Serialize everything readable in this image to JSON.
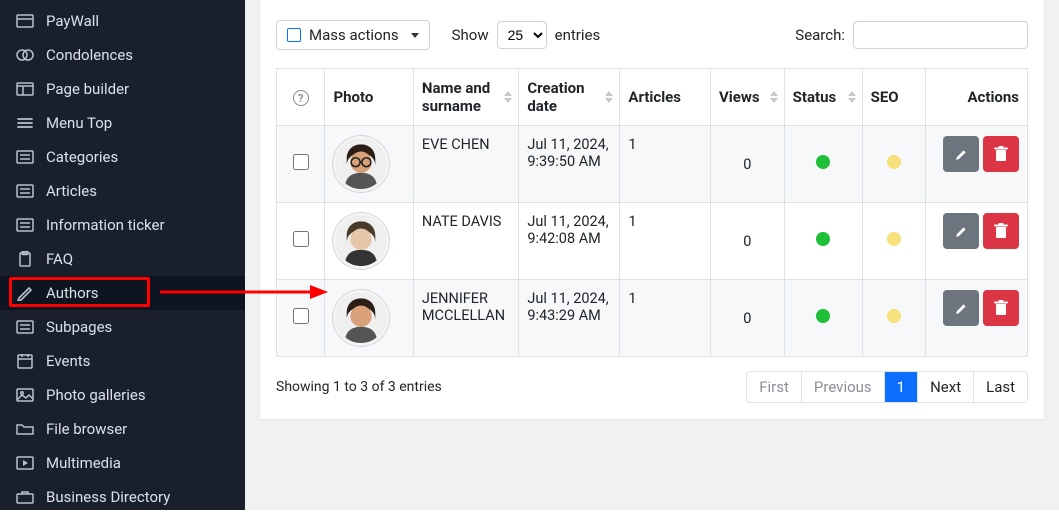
{
  "sidebar": {
    "items": [
      {
        "label": "PayWall"
      },
      {
        "label": "Condolences"
      },
      {
        "label": "Page builder"
      },
      {
        "label": "Menu Top"
      },
      {
        "label": "Categories"
      },
      {
        "label": "Articles"
      },
      {
        "label": "Information ticker"
      },
      {
        "label": "FAQ"
      },
      {
        "label": "Authors",
        "active": true
      },
      {
        "label": "Subpages"
      },
      {
        "label": "Events"
      },
      {
        "label": "Photo galleries"
      },
      {
        "label": "File browser"
      },
      {
        "label": "Multimedia"
      },
      {
        "label": "Business Directory"
      }
    ]
  },
  "topbar": {
    "mass_actions_label": "Mass actions",
    "show_label": "Show",
    "entries_label": "entries",
    "page_size": "25",
    "search_label": "Search:"
  },
  "columns": {
    "photo": "Photo",
    "name": "Name and surname",
    "date": "Creation date",
    "articles": "Articles",
    "views": "Views",
    "status": "Status",
    "seo": "SEO",
    "actions": "Actions"
  },
  "rows": [
    {
      "name": "EVE CHEN",
      "date": "Jul 11, 2024, 9:39:50 AM",
      "articles": "1",
      "views": "0",
      "status": "green",
      "seo": "yellow",
      "avatar_tone": "#d9a17a"
    },
    {
      "name": "NATE DAVIS",
      "date": "Jul 11, 2024, 9:42:08 AM",
      "articles": "1",
      "views": "0",
      "status": "green",
      "seo": "yellow",
      "avatar_tone": "#e6c6a8"
    },
    {
      "name": "JENNIFER MCCLELLAN",
      "date": "Jul 11, 2024, 9:43:29 AM",
      "articles": "1",
      "views": "0",
      "status": "green",
      "seo": "yellow",
      "avatar_tone": "#d9a17a"
    }
  ],
  "footer": {
    "info": "Showing 1 to 3 of 3 entries",
    "first": "First",
    "previous": "Previous",
    "page": "1",
    "next": "Next",
    "last": "Last"
  },
  "colors": {
    "sidebar_bg": "#19202c",
    "primary": "#0d6efd",
    "danger": "#dc3545",
    "muted_btn": "#6c757d",
    "green_dot": "#1fbf3a",
    "yellow_dot": "#f7e17a",
    "highlight": "#ff0000"
  }
}
